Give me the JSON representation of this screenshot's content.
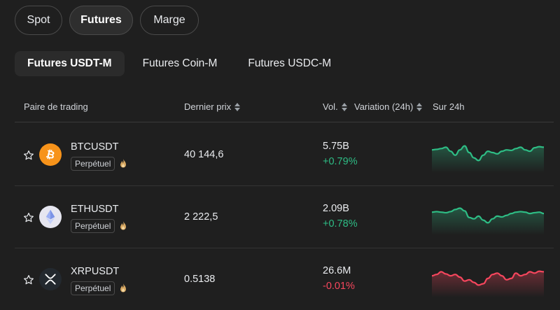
{
  "market_tabs": [
    {
      "label": "Spot",
      "active": false
    },
    {
      "label": "Futures",
      "active": true
    },
    {
      "label": "Marge",
      "active": false
    }
  ],
  "futures_tabs": [
    {
      "label": "Futures USDT-M",
      "active": true
    },
    {
      "label": "Futures Coin-M",
      "active": false
    },
    {
      "label": "Futures USDC-M",
      "active": false
    }
  ],
  "table": {
    "headers": {
      "pair": "Paire de trading",
      "price": "Dernier prix",
      "vol": "Vol.",
      "change": "Variation (24h)",
      "chart": "Sur 24h"
    },
    "rows": [
      {
        "pair": "BTCUSDT",
        "badge": "Perpétuel",
        "price": "40 144,6",
        "vol": "5.75B",
        "change": "+0.79%",
        "trend": "up",
        "spark": [
          0.6,
          0.62,
          0.65,
          0.7,
          0.55,
          0.4,
          0.6,
          0.75,
          0.5,
          0.3,
          0.2,
          0.4,
          0.55,
          0.5,
          0.45,
          0.55,
          0.6,
          0.58,
          0.65,
          0.7,
          0.6,
          0.55,
          0.68,
          0.72,
          0.7
        ]
      },
      {
        "pair": "ETHUSDT",
        "badge": "Perpétuel",
        "price": "2 222,5",
        "vol": "2.09B",
        "change": "+0.78%",
        "trend": "up",
        "spark": [
          0.6,
          0.62,
          0.6,
          0.58,
          0.62,
          0.7,
          0.75,
          0.65,
          0.4,
          0.35,
          0.45,
          0.3,
          0.2,
          0.35,
          0.45,
          0.42,
          0.48,
          0.55,
          0.6,
          0.62,
          0.6,
          0.55,
          0.58,
          0.6,
          0.55
        ]
      },
      {
        "pair": "XRPUSDT",
        "badge": "Perpétuel",
        "price": "0.5138",
        "vol": "26.6M",
        "change": "-0.01%",
        "trend": "down",
        "spark": [
          0.55,
          0.6,
          0.7,
          0.62,
          0.55,
          0.6,
          0.5,
          0.35,
          0.4,
          0.3,
          0.2,
          0.25,
          0.45,
          0.6,
          0.65,
          0.55,
          0.4,
          0.45,
          0.65,
          0.55,
          0.6,
          0.7,
          0.65,
          0.72,
          0.7
        ]
      }
    ]
  },
  "colors": {
    "up": "#2ebd85",
    "down": "#f6465d",
    "btc": "#f7931a",
    "bg": "#1f1f1f"
  },
  "icons": [
    "star-icon",
    "bitcoin-icon",
    "ethereum-icon",
    "xrp-icon",
    "fire-icon",
    "sort-icon"
  ]
}
